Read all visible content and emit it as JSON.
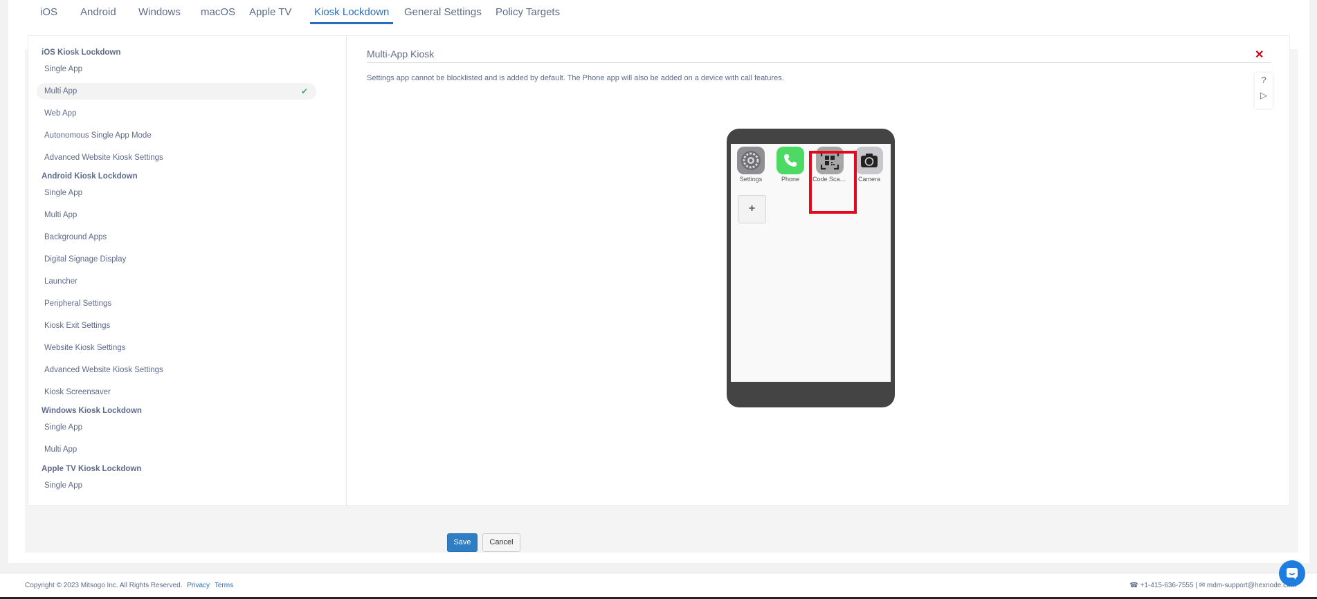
{
  "tabs": [
    "iOS",
    "Android",
    "Windows",
    "macOS",
    "Apple TV",
    "Kiosk Lockdown",
    "General Settings",
    "Policy Targets"
  ],
  "sidebar": {
    "ios_title": "iOS Kiosk Lockdown",
    "ios_items": [
      "Single App",
      "Multi App",
      "Web App",
      "Autonomous Single App Mode",
      "Advanced Website Kiosk Settings"
    ],
    "android_title": "Android Kiosk Lockdown",
    "android_items": [
      "Single App",
      "Multi App",
      "Background Apps",
      "Digital Signage Display",
      "Launcher",
      "Peripheral Settings",
      "Kiosk Exit Settings",
      "Website Kiosk Settings",
      "Advanced Website Kiosk Settings",
      "Kiosk Screensaver"
    ],
    "windows_title": "Windows Kiosk Lockdown",
    "windows_items": [
      "Single App",
      "Multi App"
    ],
    "appletv_title": "Apple TV Kiosk Lockdown",
    "appletv_items": [
      "Single App"
    ],
    "check_icon": "checkmark-icon"
  },
  "content": {
    "title": "Multi-App Kiosk",
    "description": "Settings app cannot be blocklisted and is added by default. The Phone app will also be added on a device with call features.",
    "help": "?",
    "play": "▷",
    "close": "✕"
  },
  "phone": {
    "apps": [
      "Settings",
      "Phone",
      "Code Scanner",
      "Camera"
    ],
    "add": "+"
  },
  "buttons": {
    "save": "Save",
    "cancel": "Cancel"
  },
  "footer": {
    "copyright": "Copyright © 2023 Mitsogo Inc. All Rights Reserved.",
    "privacy": "Privacy",
    "terms": "Terms",
    "phone": "+1-415-636-7555",
    "separator": "|",
    "email": "mdm-support@hexnode.com"
  },
  "colors": {
    "accent": "#2a6ebb",
    "highlight": "#e1091b",
    "check": "#3cae5c"
  }
}
